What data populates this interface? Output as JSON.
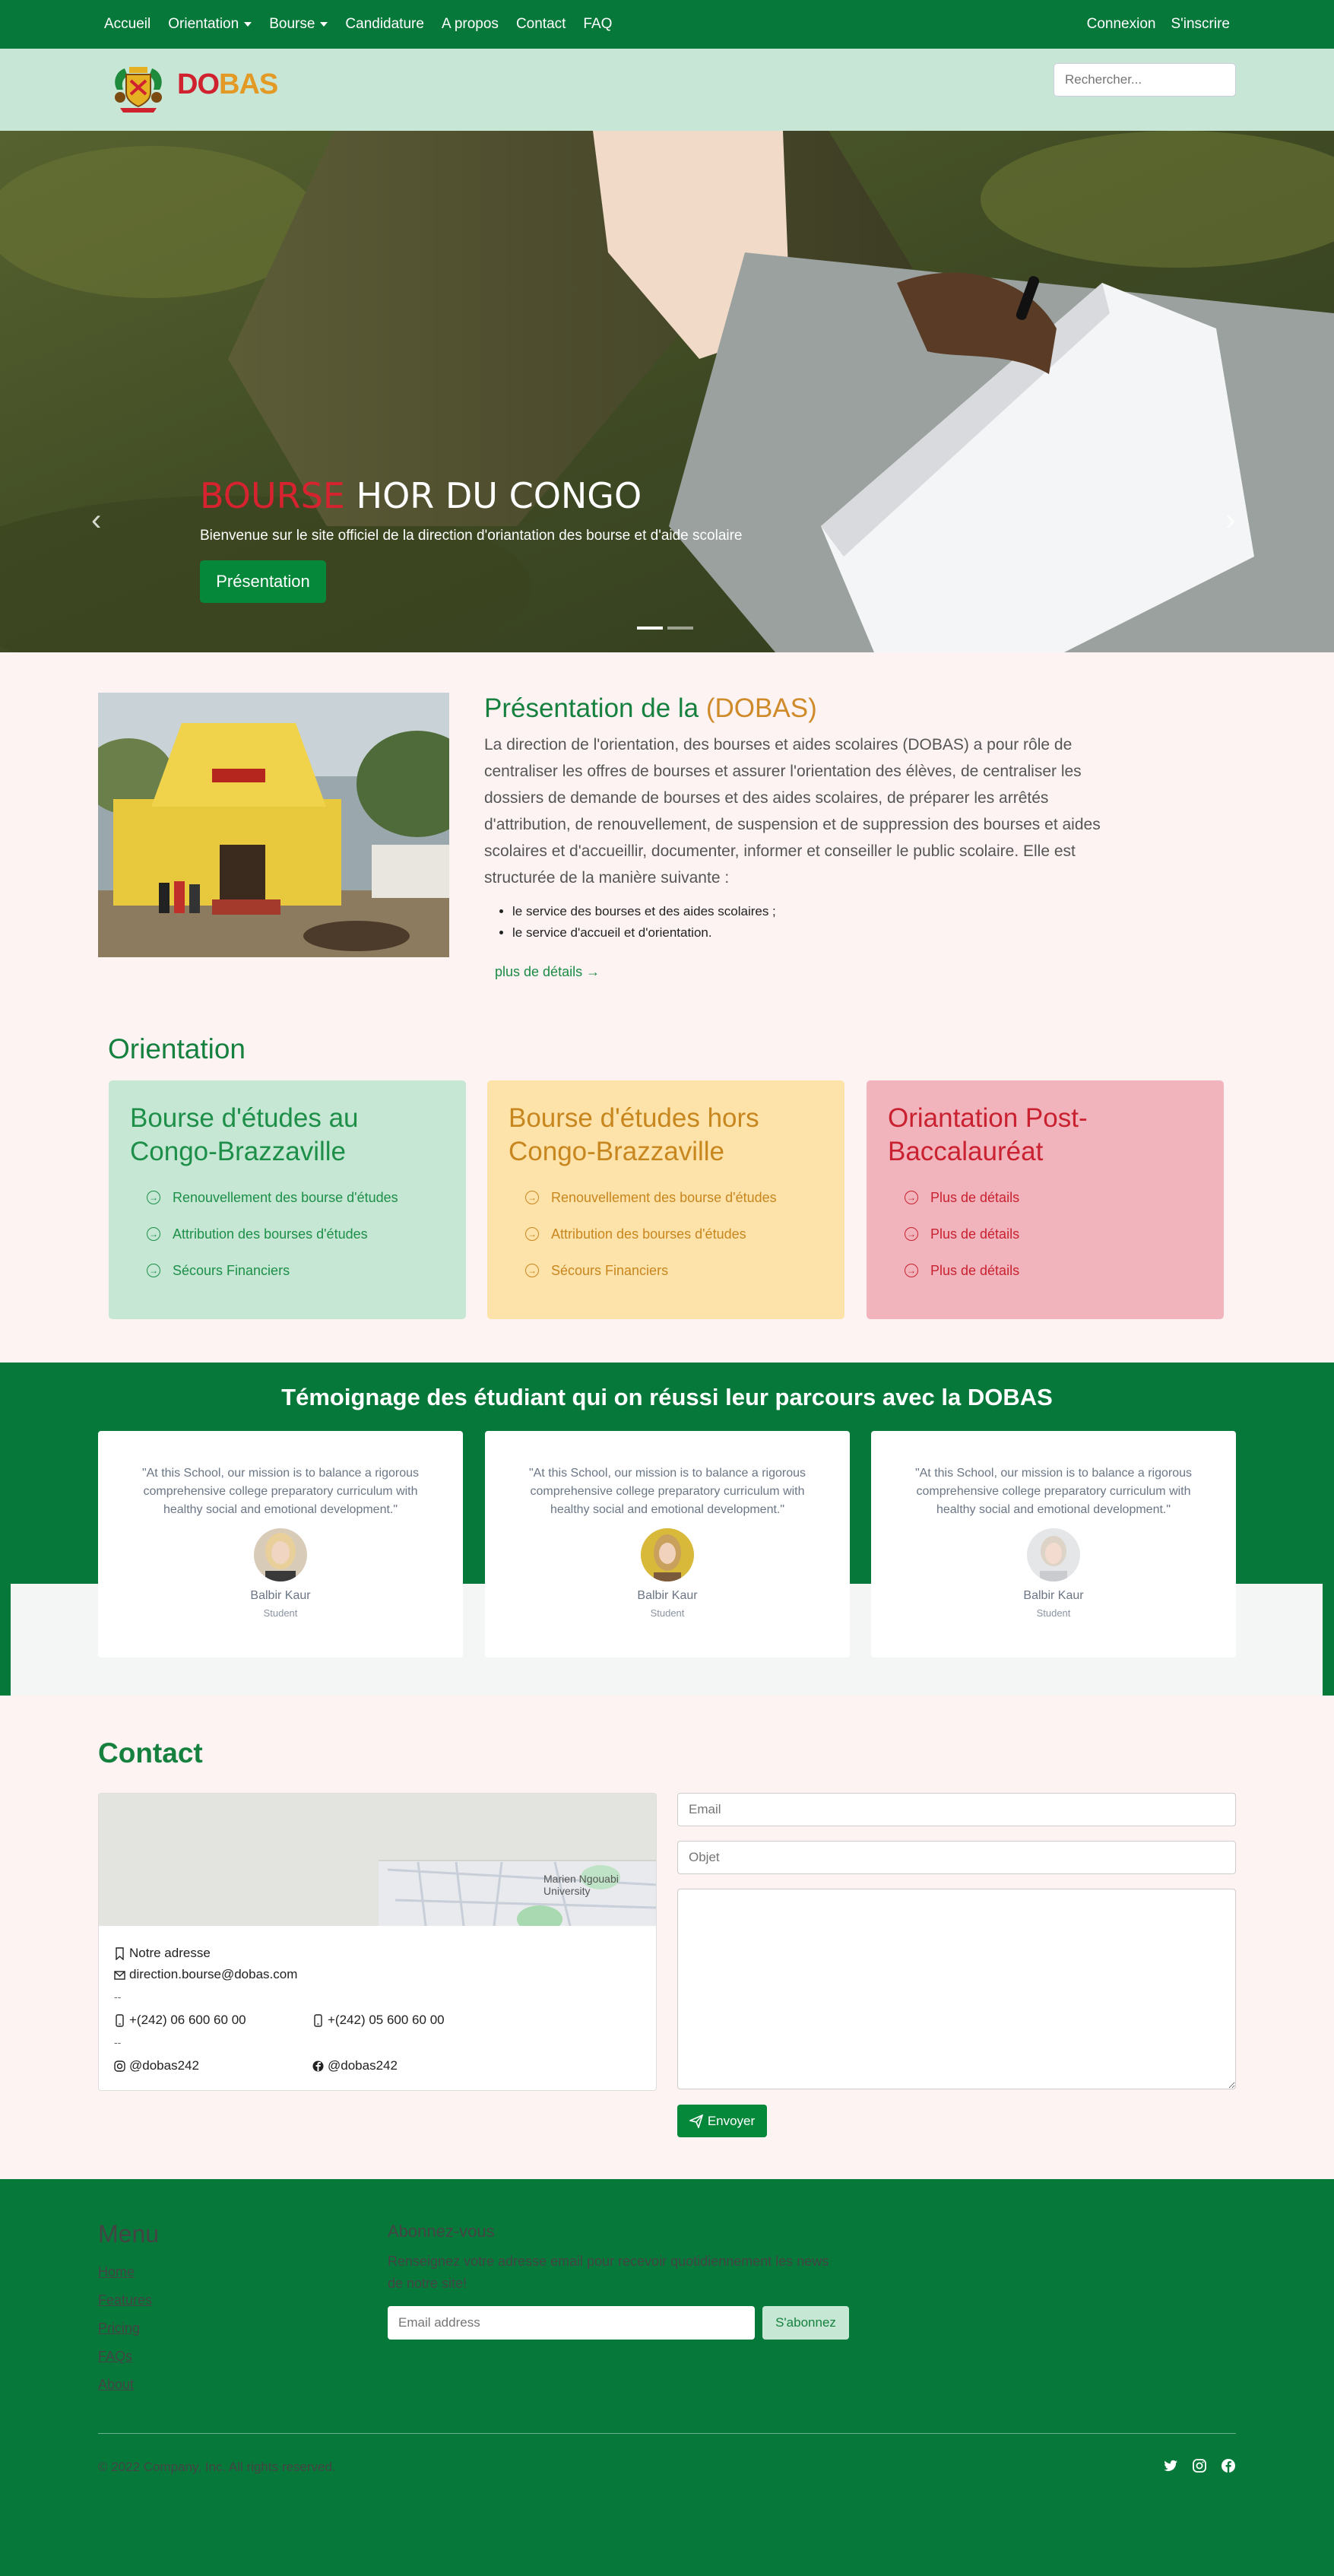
{
  "topnav": {
    "items": [
      {
        "label": "Accueil"
      },
      {
        "label": "Orientation"
      },
      {
        "label": "Bourse"
      },
      {
        "label": "Candidature"
      },
      {
        "label": "A propos"
      },
      {
        "label": "Contact"
      },
      {
        "label": "FAQ"
      }
    ],
    "login": "Connexion",
    "signup": "S'inscrire"
  },
  "header": {
    "brand_do": "DO",
    "brand_bas": "BAS",
    "search_placeholder": "Rechercher..."
  },
  "hero": {
    "title_red": "BOURSE",
    "title_white": " HOR DU CONGO",
    "subtitle": "Bienvenue sur le site officiel de la direction d'oriantation des bourse et d'aide scolaire",
    "button": "Présentation",
    "slides_count": 2,
    "active_slide": 1
  },
  "presentation": {
    "title_prefix": "Présentation de la ",
    "title_org": "(DOBAS)",
    "text": "La direction de l'orientation, des bourses et aides scolaires (DOBAS) a pour rôle de centraliser les offres de bourses et assurer l'orientation des élèves, de centraliser les dossiers de demande de bourses et des aides scolaires, de préparer les arrêtés d'attribution, de renouvellement, de suspension et de suppression des bourses et aides scolaires et d'accueillir, documenter, informer et conseiller le public scolaire. Elle est structurée de la manière suivante :",
    "list": [
      "le service des bourses et des aides scolaires ;",
      "le service d'accueil et d'orientation."
    ],
    "more": "plus de détails"
  },
  "orientation": {
    "title": "Orientation",
    "cards": [
      {
        "title": "Bourse d'études au Congo-Brazzaville",
        "links": [
          "Renouvellement des bourse d'études",
          "Attribution des bourses d'études",
          "Sécours Financiers"
        ]
      },
      {
        "title": "Bourse d'études hors Congo-Brazzaville",
        "links": [
          "Renouvellement des bourse d'études",
          "Attribution des bourses d'études",
          "Sécours Financiers"
        ]
      },
      {
        "title": "Oriantation Post-Baccalauréat",
        "links": [
          "Plus de détails",
          "Plus de détails",
          "Plus de détails"
        ]
      }
    ]
  },
  "testimonials": {
    "title": "Témoignage des étudiant qui on réussi leur parcours avec la DOBAS",
    "items": [
      {
        "quote": "\"At this School, our mission is to balance a rigorous comprehensive college preparatory curriculum with healthy social and emotional development.\"",
        "name": "Balbir Kaur",
        "role": "Student"
      },
      {
        "quote": "\"At this School, our mission is to balance a rigorous comprehensive college preparatory curriculum with healthy social and emotional development.\"",
        "name": "Balbir Kaur",
        "role": "Student"
      },
      {
        "quote": "\"At this School, our mission is to balance a rigorous comprehensive college preparatory curriculum with healthy social and emotional development.\"",
        "name": "Balbir Kaur",
        "role": "Student"
      }
    ]
  },
  "contact": {
    "title": "Contact",
    "map_label": "Marien Ngouabi University",
    "address": "Notre adresse",
    "email": "direction.bourse@dobas.com",
    "dash": "--",
    "phone1": "+(242) 06 600 60 00",
    "phone2": "+(242) 05 600 60 00",
    "instagram": "@dobas242",
    "facebook": "@dobas242",
    "form": {
      "email_placeholder": "Email",
      "subject_placeholder": "Objet",
      "send": "Envoyer"
    }
  },
  "footer": {
    "menu_title": "Menu",
    "menu": [
      "Home",
      "Features",
      "Pricing",
      "FAQs",
      "About"
    ],
    "subscribe_title": "Abonnez-vous",
    "subscribe_text": "Renseignez votre adresse email pour recevoir quotidiennement les news de notre site!",
    "email_placeholder": "Email address",
    "subscribe_button": "S'abonnez",
    "copyright": "© 2022 Company, Inc. All rights reserved."
  },
  "colors": {
    "primary_green": "#06783a",
    "accent_red": "#d0212f",
    "accent_orange": "#e39a25"
  }
}
